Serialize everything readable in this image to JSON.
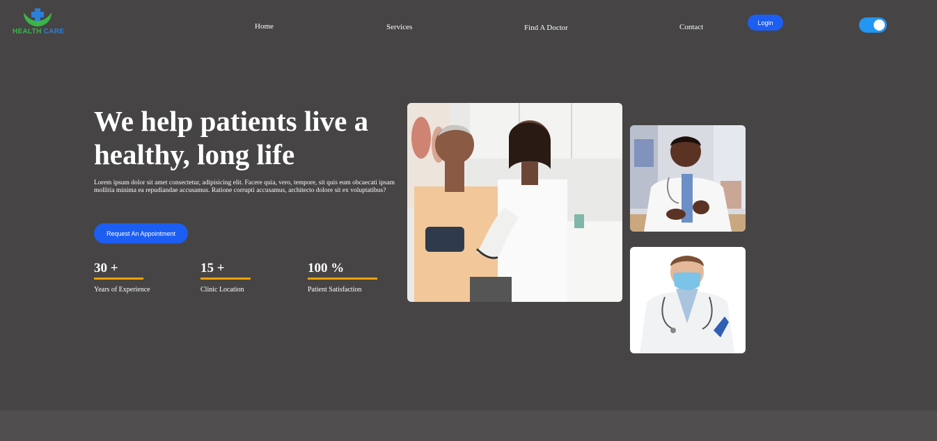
{
  "brand": {
    "word1": "HEALTH",
    "word2": "CARE",
    "icon": "caring-hands-cross-icon"
  },
  "nav": {
    "links": [
      "Home",
      "Services",
      "Find A Doctor",
      "Contact"
    ],
    "login_label": "Login",
    "theme_toggle_on": true
  },
  "hero": {
    "title": "We help patients live a healthy, long life",
    "description": "Lorem ipsum dolor sit amet consectetur, adipisicing elit. Facere quia, vero, tempore, sit quis eum obcaecati ipsam mollitia minima ea repudiandae accusamus. Ratione corrupti accusamus, architecto dolore sit ex voluptatibus?",
    "cta_label": "Request An Appointment",
    "stats": [
      {
        "value": "30 +",
        "label": "Years of Experience"
      },
      {
        "value": "15 +",
        "label": "Clinic Location"
      },
      {
        "value": "100 %",
        "label": "Patient Satisfaction"
      }
    ]
  },
  "images": {
    "main": "doctor-measuring-patient-blood-pressure-photo",
    "top": "doctor-explaining-at-desk-photo",
    "bottom": "doctor-wearing-mask-photo"
  },
  "colors": {
    "background": "#464444",
    "accent": "#1c5ef2",
    "stat_bar": "#f5a100",
    "toggle": "#2196f3"
  }
}
